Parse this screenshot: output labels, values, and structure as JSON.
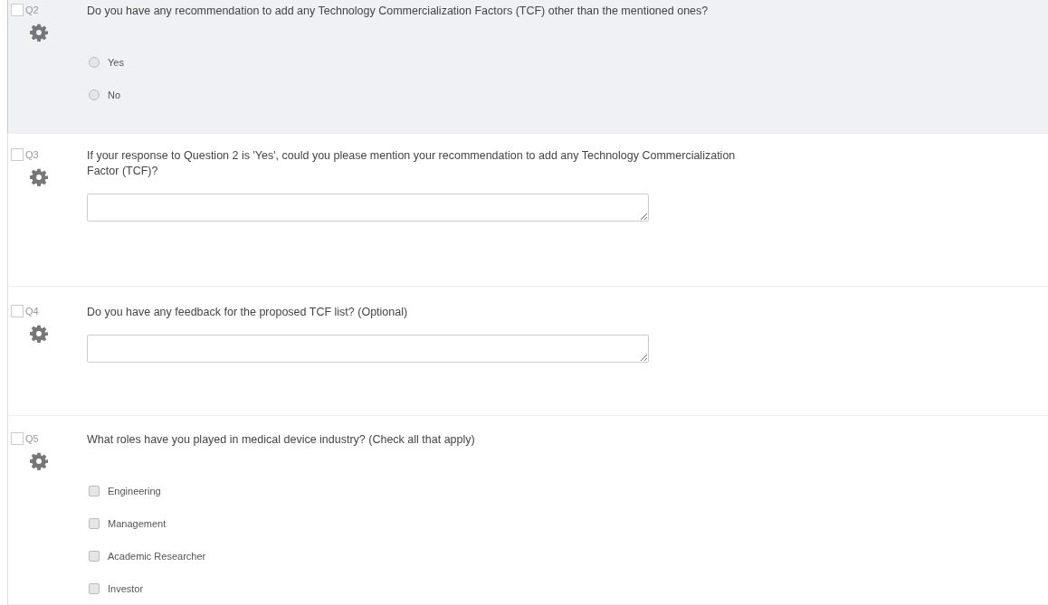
{
  "questions": [
    {
      "number": "Q2",
      "checked": false,
      "selected": true,
      "kind": "single",
      "text": "Do you have any recommendation to add any Technology Commercialization Factors (TCF) other than the mentioned ones?",
      "options": [
        {
          "label": "Yes",
          "selected": false
        },
        {
          "label": "No",
          "selected": false
        }
      ]
    },
    {
      "number": "Q3",
      "checked": false,
      "selected": false,
      "kind": "text",
      "text": "If your response to Question 2 is 'Yes', could you please mention your recommendation to add any Technology Commercialization Factor (TCF)?"
    },
    {
      "number": "Q4",
      "checked": false,
      "selected": false,
      "kind": "text",
      "text": "Do you have any feedback for the proposed TCF list? (Optional)"
    },
    {
      "number": "Q5",
      "checked": false,
      "selected": false,
      "kind": "multi",
      "text": "What roles have you played in medical device industry? (Check all that apply)",
      "options": [
        {
          "label": "Engineering",
          "checked": false
        },
        {
          "label": "Management",
          "checked": false
        },
        {
          "label": "Academic Researcher",
          "checked": false
        },
        {
          "label": "Investor",
          "checked": false
        }
      ]
    }
  ]
}
